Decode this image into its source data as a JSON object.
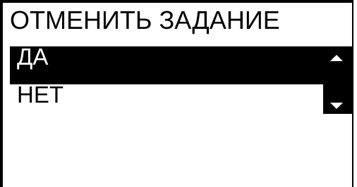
{
  "dialog": {
    "title": "ОТМЕНИТЬ ЗАДАНИЕ"
  },
  "options": [
    {
      "label": "ДА",
      "selected": true
    },
    {
      "label": "НЕТ",
      "selected": false
    }
  ],
  "scrollbar": {
    "up_icon": "triangle-up-icon",
    "down_icon": "triangle-down-icon"
  },
  "colors": {
    "background": "#ffffff",
    "foreground": "#000000",
    "selected_background": "#000000",
    "selected_text": "#ffffff"
  }
}
